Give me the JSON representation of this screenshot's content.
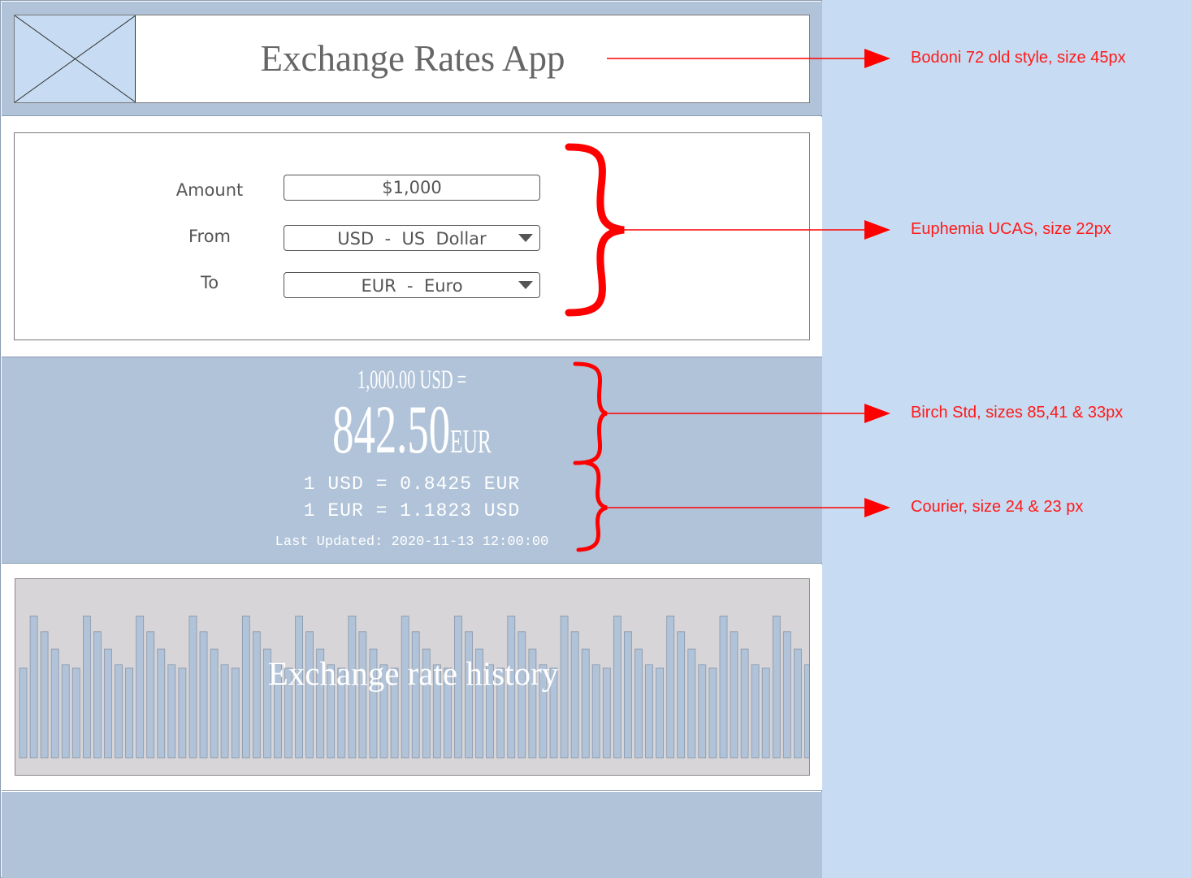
{
  "header": {
    "title": "Exchange Rates App"
  },
  "form": {
    "amount_label": "Amount",
    "amount_value": "$1,000",
    "from_label": "From",
    "from_value": "USD  -  US  Dollar",
    "to_label": "To",
    "to_value": "EUR  -  Euro"
  },
  "result": {
    "source_line": "1,000.00 USD =",
    "amount": "842.50",
    "currency": "EUR",
    "rate_forward": "1 USD = 0.8425 EUR",
    "rate_reverse": "1 EUR = 1.1823 USD",
    "last_updated": "Last Updated: 2020-11-13 12:00:00"
  },
  "history": {
    "title": "Exchange rate history",
    "bar_pattern": [
      0.57,
      0.9,
      0.8,
      0.69,
      0.59
    ]
  },
  "annotations": [
    "Bodoni 72 old style, size 45px",
    "Euphemia UCAS, size 22px",
    "Birch Std, sizes 85,41 & 33px",
    "Courier, size 24 & 23 px"
  ],
  "colors": {
    "band_blue": "#b1c3d9",
    "page_background": "#c7dcf2",
    "annotation_red": "#ff0000",
    "chart_bar": "#b1c3d9",
    "chart_background": "#d7d5d8"
  }
}
